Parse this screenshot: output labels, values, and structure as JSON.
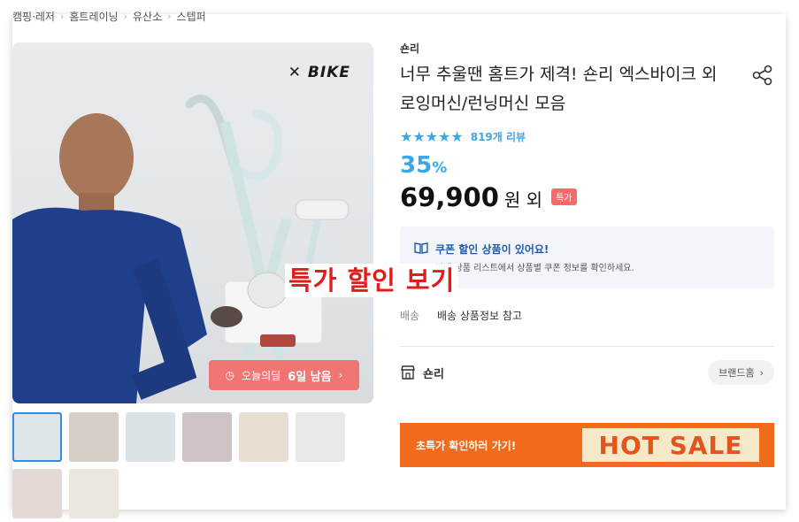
{
  "breadcrumb": {
    "items": [
      "캠핑·레저",
      "홈트레이닝",
      "유산소",
      "스텝퍼"
    ]
  },
  "main_image": {
    "brand_logo": "BIKE",
    "deal_badge_label": "오늘의딜",
    "deal_badge_remaining": "6일 남음"
  },
  "overlay": {
    "text": "특가 할인 보기"
  },
  "thumbnails": {
    "count": 8,
    "selected_index": 0
  },
  "product": {
    "seller": "숀리",
    "title": "너무 추울땐 홈트가 제격! 숀리 엑스바이크 외 로잉머신/런닝머신 모음",
    "stars": "★★★★★",
    "review_count": "819개 리뷰",
    "discount_value": "35",
    "discount_unit": "%",
    "price": "69,900",
    "price_suffix": "원 외",
    "special_badge": "특가"
  },
  "coupon": {
    "title": "쿠폰 할인 상품이 있어요!",
    "description": "아래 상품 리스트에서 상품별 쿠폰 정보를 확인하세요."
  },
  "shipping": {
    "label": "배송",
    "value": "배송 상품정보 참고"
  },
  "brand": {
    "name": "숀리",
    "home_button": "브랜드홈"
  },
  "banner": {
    "text": "초특가 확인하러 가기!",
    "hot_sale": "HOT SALE"
  },
  "colors": {
    "accent": "#3aa7e8",
    "deal": "#f27575",
    "banner": "#f26a1c",
    "overlay": "#e31b1b"
  }
}
